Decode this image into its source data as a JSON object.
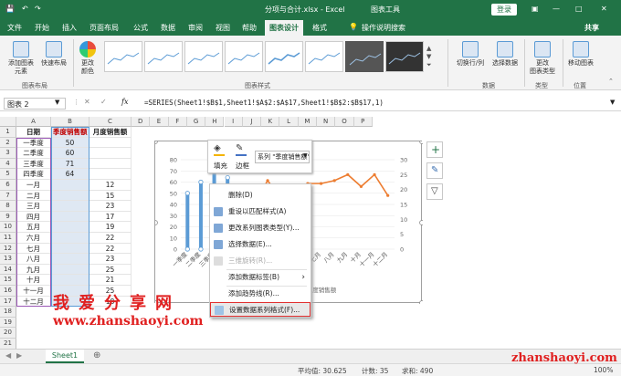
{
  "titlebar": {
    "filename": "分项与合计.xlsx - Excel",
    "tools": "图表工具",
    "login": "登录"
  },
  "tabs": [
    "文件",
    "开始",
    "插入",
    "页面布局",
    "公式",
    "数据",
    "审阅",
    "视图",
    "帮助",
    "图表设计",
    "格式"
  ],
  "tell_me": "操作说明搜索",
  "share": "共享",
  "ribbon": {
    "add_element": "添加图表\n元素",
    "quick_layout": "快速布局",
    "change_colors": "更改\n颜色",
    "group_layout": "图表布局",
    "group_styles": "图表样式",
    "switch_rowcol": "切换行/列",
    "select_data": "选择数据",
    "group_data": "数据",
    "change_type": "更改\n图表类型",
    "group_type": "类型",
    "move_chart": "移动图表",
    "group_location": "位置"
  },
  "formula_bar": {
    "name_box": "图表 2",
    "fx": "fx",
    "formula": "=SERIES(Sheet1!$B$1,Sheet1!$A$2:$A$17,Sheet1!$B$2:$B$17,1)"
  },
  "columns": [
    "A",
    "B",
    "C",
    "D",
    "E",
    "F",
    "G",
    "H",
    "I",
    "J",
    "K",
    "L",
    "M",
    "N",
    "O",
    "P"
  ],
  "rows": [
    "1",
    "2",
    "3",
    "4",
    "5",
    "6",
    "7",
    "8",
    "9",
    "10",
    "11",
    "12",
    "13",
    "14",
    "15",
    "16",
    "17",
    "18",
    "19",
    "20",
    "21"
  ],
  "sheet_rows": [
    [
      "日期",
      "季度销售额",
      "月度销售额"
    ],
    [
      "一季度",
      "50",
      ""
    ],
    [
      "二季度",
      "60",
      ""
    ],
    [
      "三季度",
      "71",
      ""
    ],
    [
      "四季度",
      "64",
      ""
    ],
    [
      "一月",
      "",
      "12"
    ],
    [
      "二月",
      "",
      "15"
    ],
    [
      "三月",
      "",
      "23"
    ],
    [
      "四月",
      "",
      "17"
    ],
    [
      "五月",
      "",
      "19"
    ],
    [
      "六月",
      "",
      "22"
    ],
    [
      "七月",
      "",
      "22"
    ],
    [
      "八月",
      "",
      "23"
    ],
    [
      "九月",
      "",
      "25"
    ],
    [
      "十月",
      "",
      "21"
    ],
    [
      "十一月",
      "",
      "25"
    ],
    [
      "十二月",
      "",
      "18"
    ]
  ],
  "chart_data": {
    "type": "bar",
    "categories": [
      "一季度",
      "二季度",
      "三季度",
      "四季度",
      "一月",
      "二月",
      "三月",
      "四月",
      "五月",
      "六月",
      "七月",
      "八月",
      "九月",
      "十月",
      "十一月",
      "十二月"
    ],
    "series": [
      {
        "name": "季度销售额",
        "type": "bar",
        "axis": "left",
        "values": [
          50,
          60,
          71,
          64,
          null,
          null,
          null,
          null,
          null,
          null,
          null,
          null,
          null,
          null,
          null,
          null
        ],
        "color": "#5b9bd5"
      },
      {
        "name": "月度销售额",
        "type": "line",
        "axis": "right",
        "values": [
          null,
          null,
          null,
          null,
          12,
          15,
          23,
          17,
          19,
          22,
          22,
          23,
          25,
          21,
          25,
          18
        ],
        "color": "#ed7d31"
      }
    ],
    "y_left_ticks": [
      "0",
      "10",
      "20",
      "30",
      "40",
      "50",
      "60",
      "70",
      "80"
    ],
    "y_right_ticks": [
      "0",
      "5",
      "10",
      "15",
      "20",
      "25",
      "30"
    ],
    "ylim_left": [
      0,
      80
    ],
    "ylim_right": [
      0,
      30
    ],
    "xlabel_visible": "月度销售额"
  },
  "mini_toolbar": {
    "fill": "填充",
    "outline": "边框",
    "series_select": "系列 \"季度销售额\""
  },
  "context_menu": [
    {
      "label": "删除(D)",
      "icon": "",
      "disabled": false
    },
    {
      "label": "重设以匹配样式(A)",
      "icon": "reset-icon",
      "disabled": false
    },
    {
      "label": "更改系列图表类型(Y)...",
      "icon": "chart-type-icon",
      "disabled": false
    },
    {
      "label": "选择数据(E)...",
      "icon": "select-data-icon",
      "disabled": false
    },
    {
      "label": "三维旋转(R)...",
      "icon": "rotate-3d-icon",
      "disabled": true
    },
    {
      "label": "添加数据标签(B)",
      "icon": "",
      "disabled": false,
      "submenu": true
    },
    {
      "label": "添加趋势线(R)...",
      "icon": "",
      "disabled": false
    },
    {
      "label": "设置数据系列格式(F)...",
      "icon": "format-series-icon",
      "disabled": false,
      "highlighted": true
    }
  ],
  "sheet_tab": "Sheet1",
  "status": {
    "average": "平均值: 30.625",
    "count": "计数: 35",
    "sum": "求和: 490",
    "zoom": "100%"
  },
  "watermark": {
    "line1": "我爱分享网",
    "line2": "www.zhanshaoyi.com",
    "corner": "zhanshaoyi.com"
  }
}
